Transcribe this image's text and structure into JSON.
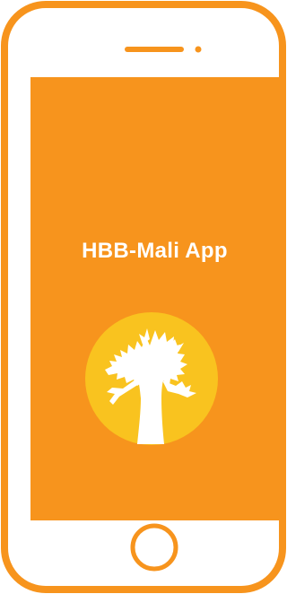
{
  "app": {
    "title": "HBB-Mali App"
  },
  "colors": {
    "phone_frame": "#F7941D",
    "screen_background": "#F7941D",
    "logo_circle": "#F9C31F",
    "logo_tree": "#FFFFFF",
    "page_background": "#FFFFFF"
  },
  "icons": {
    "speaker": "speaker-slot-icon",
    "camera": "front-camera-icon",
    "home": "home-button-icon",
    "logo": "baobab-tree-logo"
  }
}
